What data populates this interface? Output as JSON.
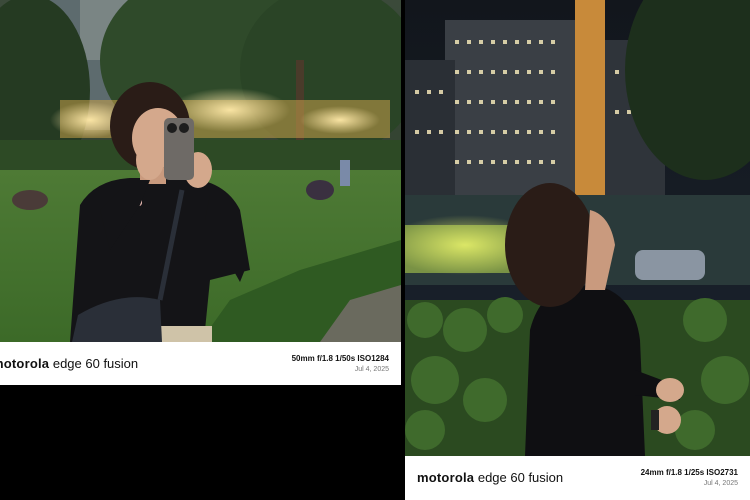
{
  "left_photo": {
    "brand": "motorola",
    "model": "edge 60 fusion",
    "exif": "50mm  f/1.8  1/50s  ISO1284",
    "date": "Jul 4, 2025"
  },
  "right_photo": {
    "brand": "motorola",
    "model": "edge 60 fusion",
    "exif": "24mm  f/1.8  1/25s  ISO2731",
    "date": "Jul 4, 2025"
  },
  "colors": {
    "frame_bg": "#ffffff",
    "text_primary": "#111111",
    "text_secondary": "#777777",
    "background": "#000000"
  }
}
